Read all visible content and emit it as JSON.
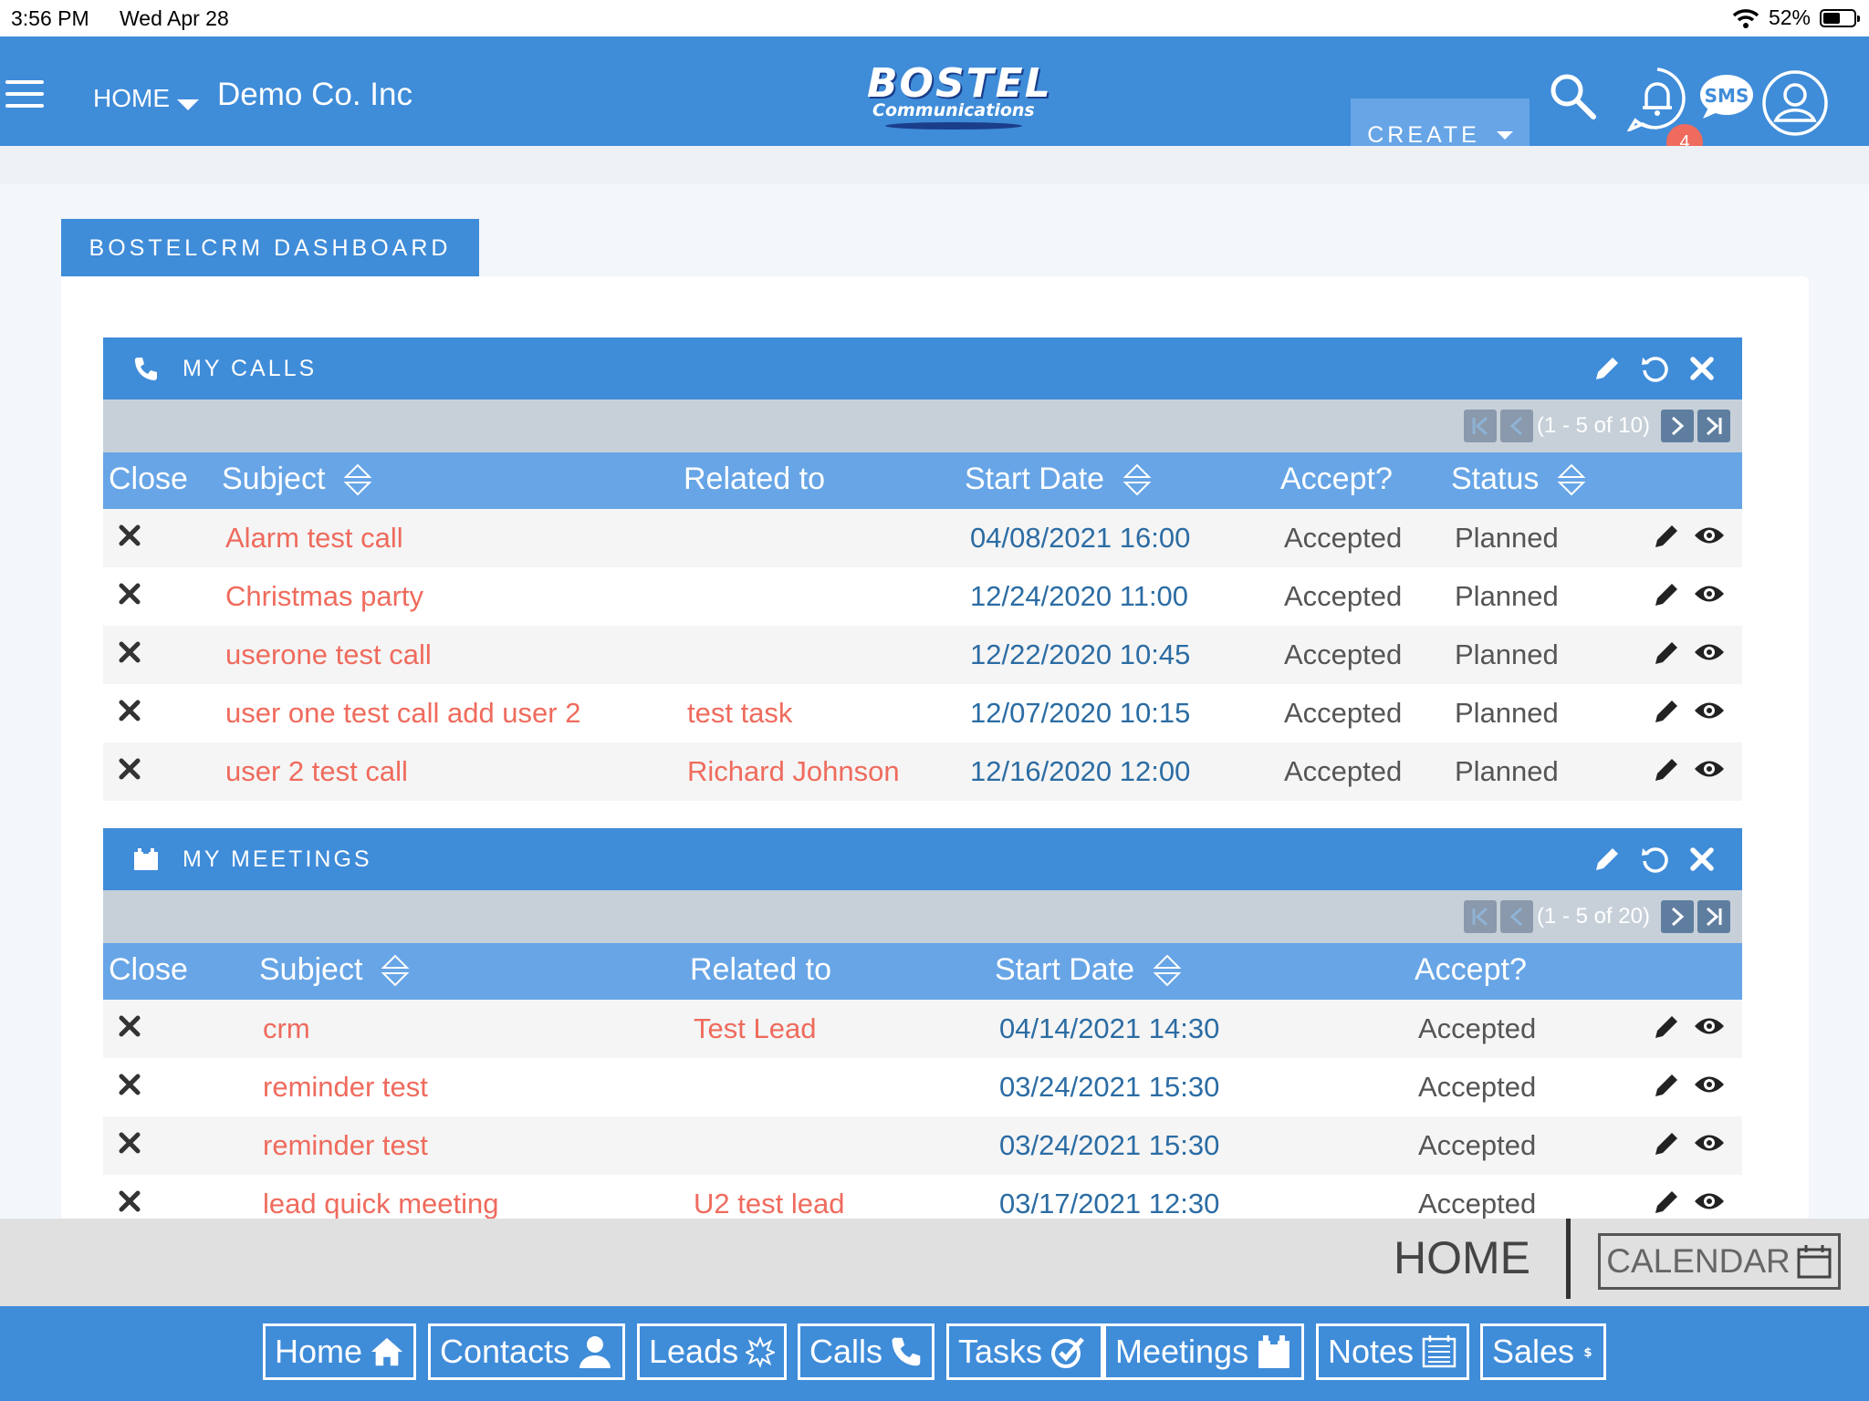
{
  "status_bar": {
    "time": "3:56 PM",
    "date": "Wed Apr 28",
    "battery": "52%"
  },
  "header": {
    "home_label": "HOME",
    "company": "Demo Co. Inc",
    "logo_line1": "BOSTEL",
    "logo_line2": "Communications",
    "create_label": "CREATE",
    "sms_label": "SMS",
    "notification_count": "4"
  },
  "dashboard": {
    "tab_label": "BOSTELCRM DASHBOARD"
  },
  "calls": {
    "title": "MY CALLS",
    "pagination": "(1 - 5 of 10)",
    "columns": [
      "Close",
      "Subject",
      "Related to",
      "Start Date",
      "Accept?",
      "Status"
    ],
    "rows": [
      {
        "subject": "Alarm test call",
        "related": "",
        "start": "04/08/2021 16:00",
        "accept": "Accepted",
        "status": "Planned"
      },
      {
        "subject": "Christmas party",
        "related": "",
        "start": "12/24/2020 11:00",
        "accept": "Accepted",
        "status": "Planned"
      },
      {
        "subject": "userone test call",
        "related": "",
        "start": "12/22/2020 10:45",
        "accept": "Accepted",
        "status": "Planned"
      },
      {
        "subject": "user one test call add user 2",
        "related": "test task",
        "start": "12/07/2020 10:15",
        "accept": "Accepted",
        "status": "Planned"
      },
      {
        "subject": "user 2 test call",
        "related": "Richard Johnson",
        "start": "12/16/2020 12:00",
        "accept": "Accepted",
        "status": "Planned"
      }
    ]
  },
  "meetings": {
    "title": "MY MEETINGS",
    "pagination": "(1 - 5 of 20)",
    "columns": [
      "Close",
      "Subject",
      "Related to",
      "Start Date",
      "Accept?"
    ],
    "rows": [
      {
        "subject": "crm",
        "related": "Test Lead",
        "start": "04/14/2021 14:30",
        "accept": "Accepted"
      },
      {
        "subject": "reminder test",
        "related": "",
        "start": "03/24/2021 15:30",
        "accept": "Accepted"
      },
      {
        "subject": "reminder test",
        "related": "",
        "start": "03/24/2021 15:30",
        "accept": "Accepted"
      },
      {
        "subject": "lead quick meeting",
        "related": "U2 test lead",
        "start": "03/17/2021 12:30",
        "accept": "Accepted"
      }
    ]
  },
  "bottom": {
    "home_label": "HOME",
    "calendar_label": "CALENDAR",
    "nav": [
      {
        "label": "Home",
        "icon": "home-icon"
      },
      {
        "label": "Contacts",
        "icon": "person-icon"
      },
      {
        "label": "Leads",
        "icon": "starburst-icon"
      },
      {
        "label": "Calls",
        "icon": "phone-icon"
      },
      {
        "label": "Tasks",
        "icon": "check-edit-icon"
      },
      {
        "label": "Meetings",
        "icon": "calendar-icon"
      },
      {
        "label": "Notes",
        "icon": "notes-icon"
      },
      {
        "label": "Sales",
        "icon": "dollar-icon"
      }
    ]
  }
}
